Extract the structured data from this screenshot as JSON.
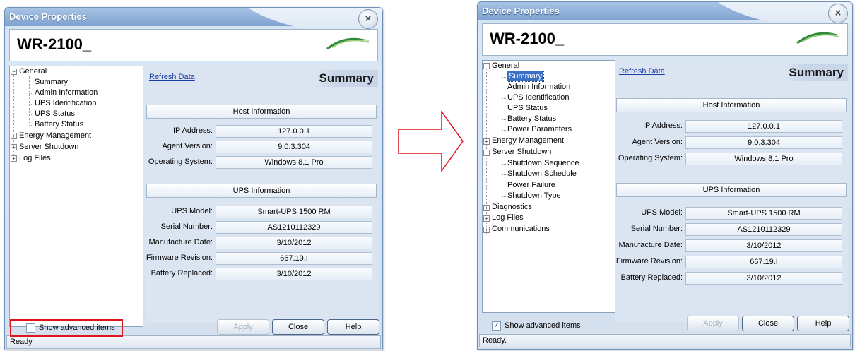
{
  "dialog_title": "Device Properties",
  "close_glyph": "×",
  "device_name": "WR-2100_",
  "refresh_label": "Refresh Data",
  "summary_title": "Summary",
  "host_section": "Host Information",
  "ups_section": "UPS Information",
  "host_info": [
    {
      "label": "IP Address:",
      "value": "127.0.0.1"
    },
    {
      "label": "Agent Version:",
      "value": "9.0.3.304"
    },
    {
      "label": "Operating System:",
      "value": "Windows 8.1 Pro"
    }
  ],
  "ups_info": [
    {
      "label": "UPS Model:",
      "value": "Smart-UPS 1500 RM"
    },
    {
      "label": "Serial Number:",
      "value": "AS1210112329"
    },
    {
      "label": "Manufacture Date:",
      "value": "3/10/2012"
    },
    {
      "label": "Firmware Revision:",
      "value": "667.19.I"
    },
    {
      "label": "Battery Replaced:",
      "value": "3/10/2012"
    }
  ],
  "show_advanced_label": "Show advanced items",
  "buttons": {
    "apply": "Apply",
    "close": "Close",
    "help": "Help"
  },
  "status_text": "Ready.",
  "tree_before": {
    "general": "General",
    "general_children": [
      "Summary",
      "Admin Information",
      "UPS Identification",
      "UPS Status",
      "Battery Status"
    ],
    "others": [
      "Energy Management",
      "Server Shutdown",
      "Log Files"
    ]
  },
  "tree_after": {
    "general": "General",
    "general_children": [
      "Summary",
      "Admin Information",
      "UPS Identification",
      "UPS Status",
      "Battery Status",
      "Power Parameters"
    ],
    "energy": "Energy Management",
    "server_shutdown": "Server Shutdown",
    "shutdown_children": [
      "Shutdown Sequence",
      "Shutdown Schedule",
      "Power Failure",
      "Shutdown Type"
    ],
    "others": [
      "Diagnostics",
      "Log Files",
      "Communications"
    ]
  },
  "checkbox_before_checked": false,
  "checkbox_after_checked": true,
  "check_glyph": "✓",
  "expand_glyph": "+",
  "collapse_glyph": "−",
  "colors": {
    "highlight": "#e0141c",
    "selection": "#3b6fc6",
    "accent": "#7ea2d0"
  }
}
